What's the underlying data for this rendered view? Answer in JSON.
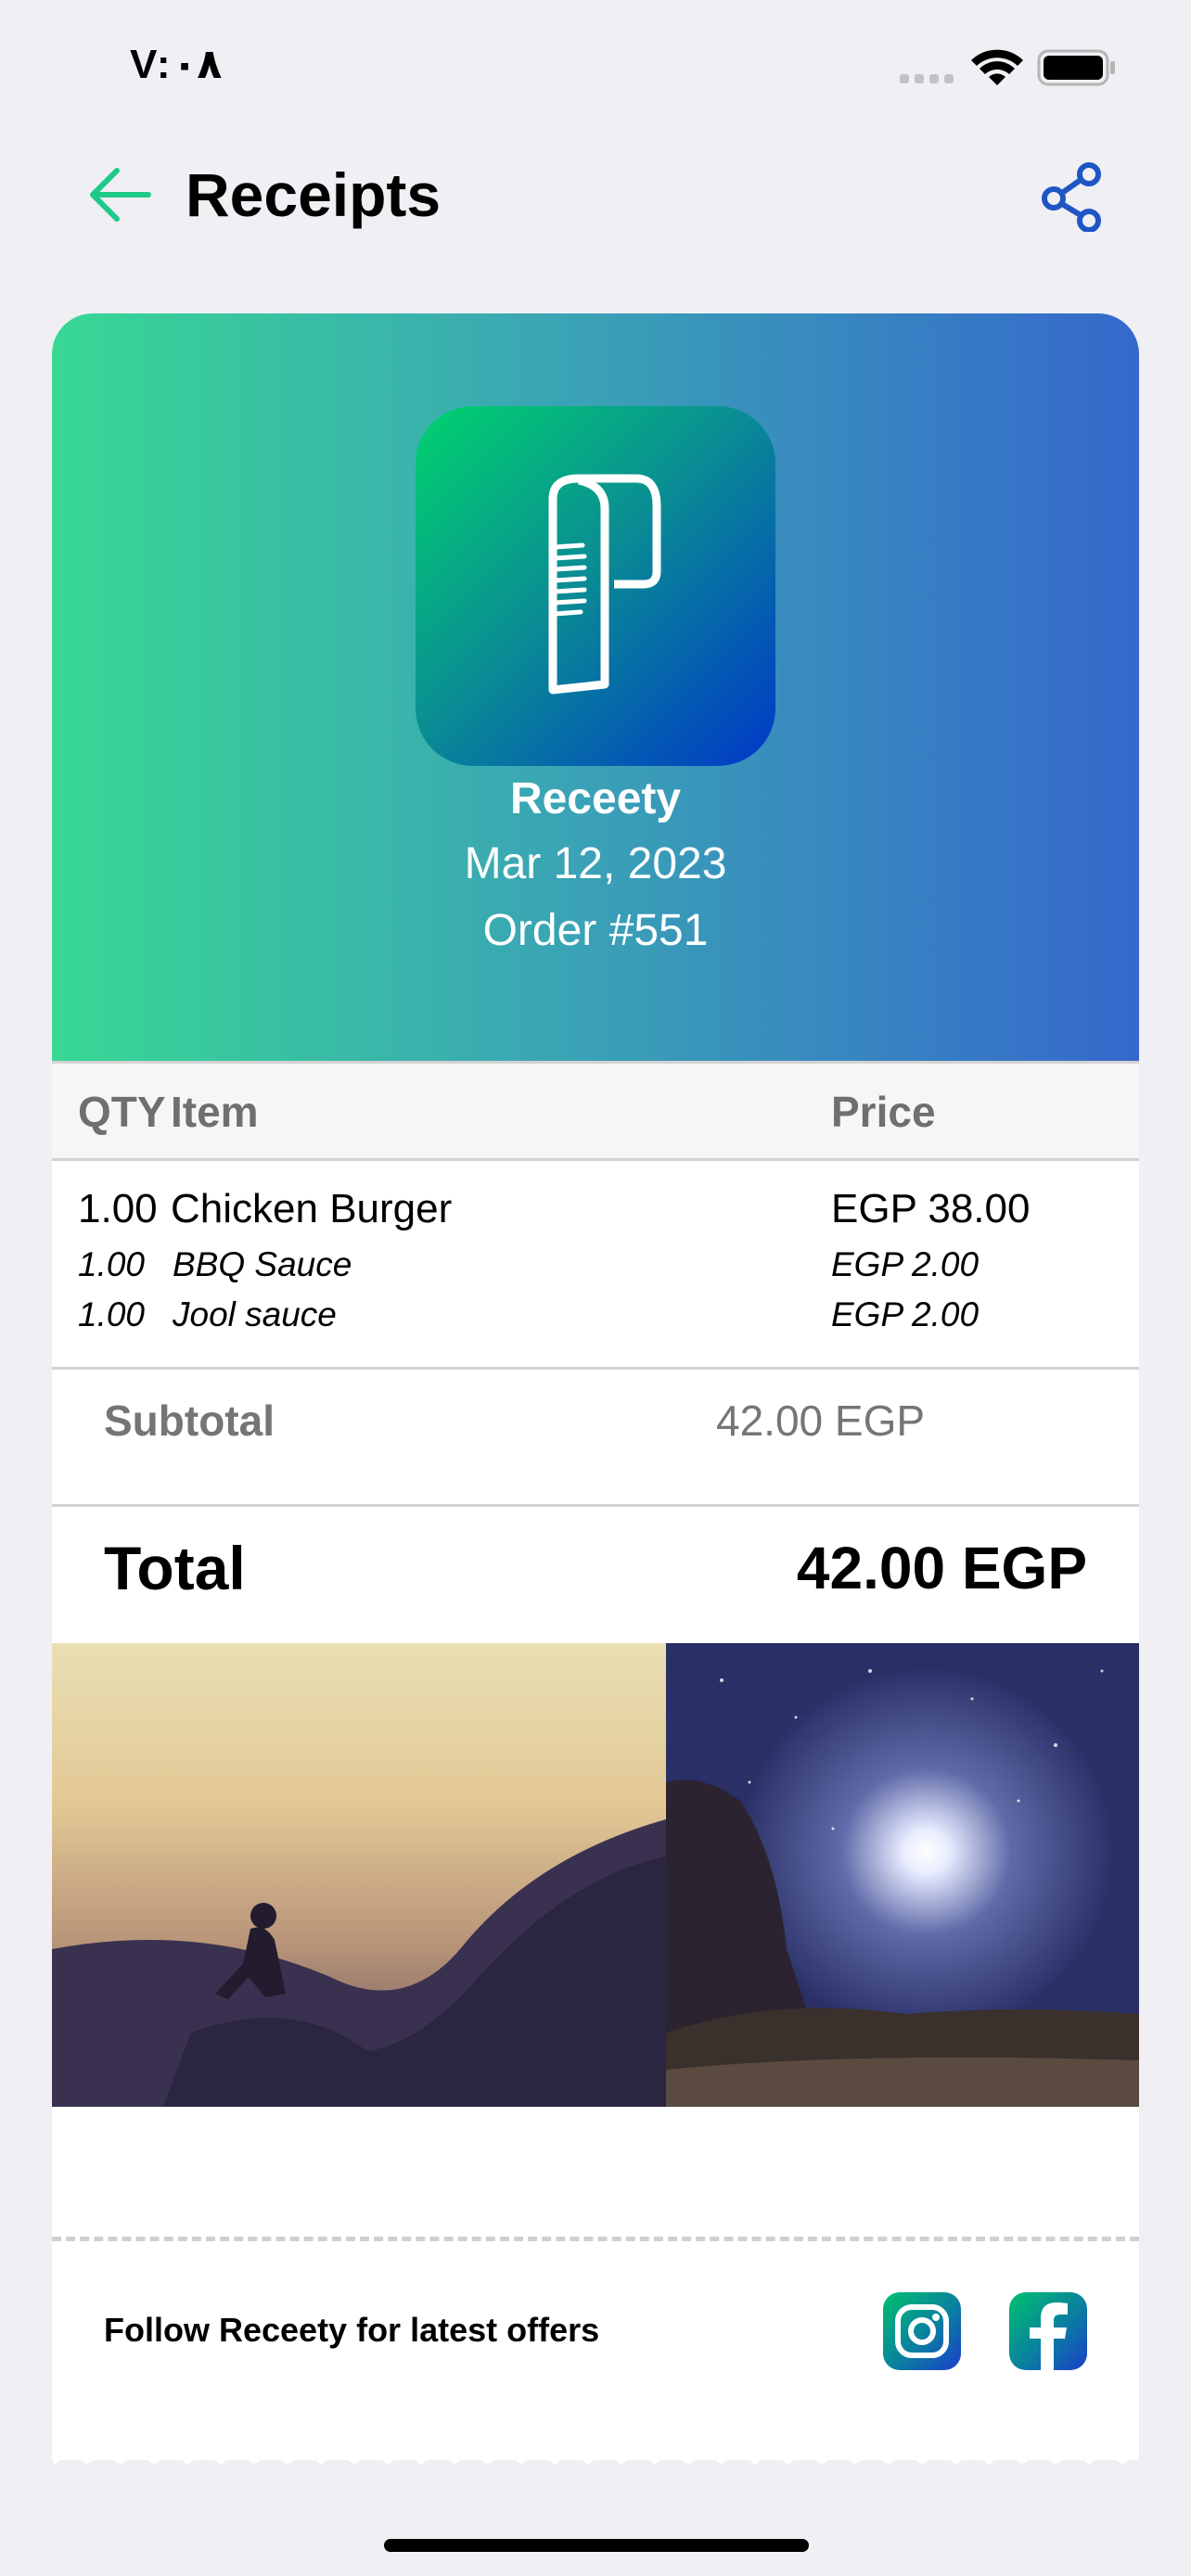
{
  "status_bar": {
    "time": "V:٠٨"
  },
  "header": {
    "title": "Receipts",
    "back_icon": "arrow-left-icon",
    "share_icon": "share-icon"
  },
  "colors": {
    "accent_green": "#1fc98a",
    "share_blue": "#1f56c4",
    "hero_left": "#38d894",
    "hero_right": "#3568cc"
  },
  "receipt": {
    "merchant": "Receety",
    "date": "Mar 12, 2023",
    "order": "Order #551",
    "table_headers": {
      "qty": "QTY",
      "item": "Item",
      "price": "Price"
    },
    "items": [
      {
        "qty": "1.00",
        "name": "Chicken Burger",
        "price": "EGP 38.00"
      },
      {
        "qty": "1.00",
        "name": "BBQ Sauce",
        "price": "EGP 2.00"
      },
      {
        "qty": "1.00",
        "name": "Jool sauce",
        "price": "EGP 2.00"
      }
    ],
    "subtotal_label": "Subtotal",
    "subtotal_value": "42.00 EGP",
    "total_label": "Total",
    "total_value": "42.00 EGP"
  },
  "footer": {
    "follow_text": "Follow Receety for latest offers",
    "icons": [
      "instagram-icon",
      "facebook-icon"
    ]
  }
}
